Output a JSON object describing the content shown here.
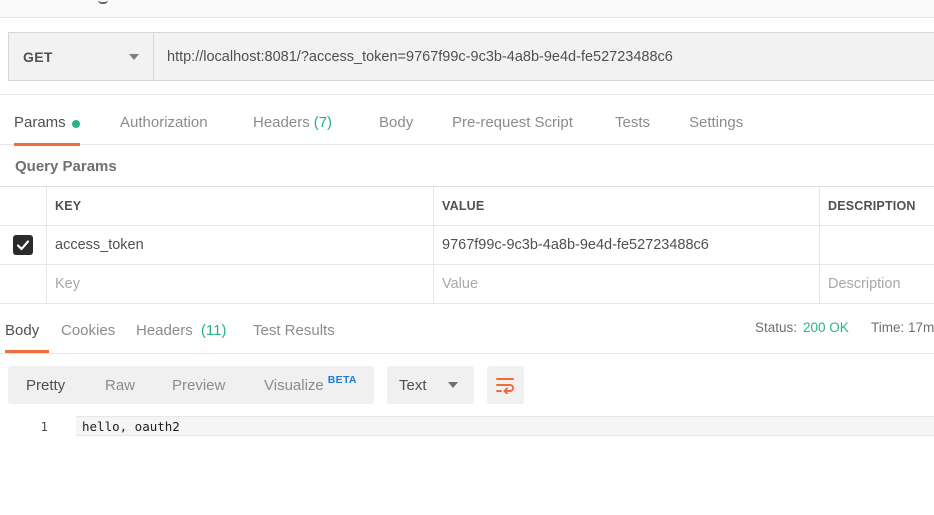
{
  "request": {
    "method": "GET",
    "url": "http://localhost:8081/?access_token=9767f99c-9c3b-4a8b-9e4d-fe52723488c6"
  },
  "request_tabs": [
    {
      "label": "Params",
      "active": true,
      "dot": true
    },
    {
      "label": "Authorization"
    },
    {
      "label": "Headers",
      "count": "(7)"
    },
    {
      "label": "Body"
    },
    {
      "label": "Pre-request Script"
    },
    {
      "label": "Tests"
    },
    {
      "label": "Settings"
    }
  ],
  "query_params": {
    "title": "Query Params",
    "columns": [
      "KEY",
      "VALUE",
      "DESCRIPTION"
    ],
    "rows": [
      {
        "checked": true,
        "key": "access_token",
        "value": "9767f99c-9c3b-4a8b-9e4d-fe52723488c6",
        "description": ""
      }
    ],
    "placeholders": {
      "key": "Key",
      "value": "Value",
      "description": "Description"
    }
  },
  "response_tabs": [
    {
      "label": "Body",
      "active": true
    },
    {
      "label": "Cookies"
    },
    {
      "label": "Headers",
      "count": "(11)"
    },
    {
      "label": "Test Results"
    }
  ],
  "status": {
    "label": "Status:",
    "value": "200 OK",
    "time_label": "Time:",
    "time_value": "17m"
  },
  "response_views": [
    "Pretty",
    "Raw",
    "Preview",
    "Visualize"
  ],
  "beta_label": "BETA",
  "format": "Text",
  "response_body": [
    {
      "line": "1",
      "text": "hello, oauth2"
    }
  ],
  "colors": {
    "accent": "#f26b3a",
    "success": "#26b47f",
    "beta": "#1a7dde"
  }
}
